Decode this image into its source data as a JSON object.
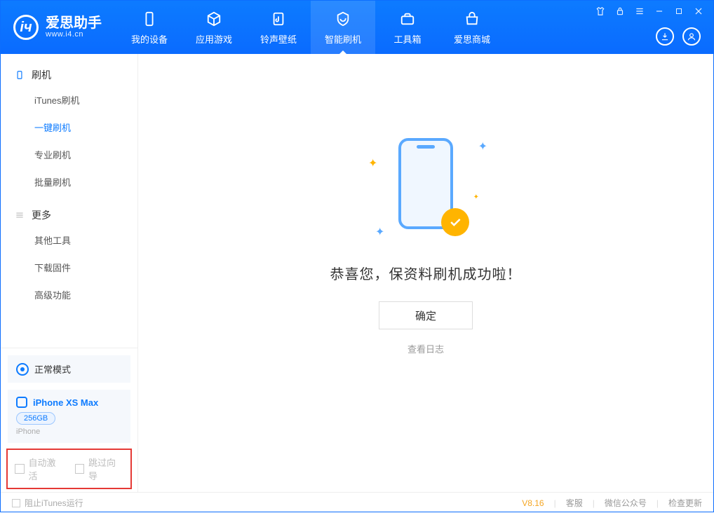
{
  "app": {
    "name": "爱思助手",
    "site": "www.i4.cn"
  },
  "nav": {
    "items": [
      {
        "label": "我的设备"
      },
      {
        "label": "应用游戏"
      },
      {
        "label": "铃声壁纸"
      },
      {
        "label": "智能刷机"
      },
      {
        "label": "工具箱"
      },
      {
        "label": "爱思商城"
      }
    ],
    "active_index": 3
  },
  "sidebar": {
    "groups": [
      {
        "title": "刷机",
        "items": [
          {
            "label": "iTunes刷机"
          },
          {
            "label": "一键刷机",
            "active": true
          },
          {
            "label": "专业刷机"
          },
          {
            "label": "批量刷机"
          }
        ]
      },
      {
        "title": "更多",
        "items": [
          {
            "label": "其他工具"
          },
          {
            "label": "下载固件"
          },
          {
            "label": "高级功能"
          }
        ]
      }
    ],
    "mode_label": "正常模式",
    "device": {
      "name": "iPhone XS Max",
      "capacity": "256GB",
      "type": "iPhone"
    },
    "options": {
      "auto_activate": "自动激活",
      "skip_guide": "跳过向导"
    }
  },
  "main": {
    "success_message": "恭喜您，保资料刷机成功啦！",
    "ok_button": "确定",
    "view_log": "查看日志"
  },
  "statusbar": {
    "block_itunes": "阻止iTunes运行",
    "version": "V8.16",
    "links": {
      "service": "客服",
      "wechat": "微信公众号",
      "update": "检查更新"
    }
  }
}
